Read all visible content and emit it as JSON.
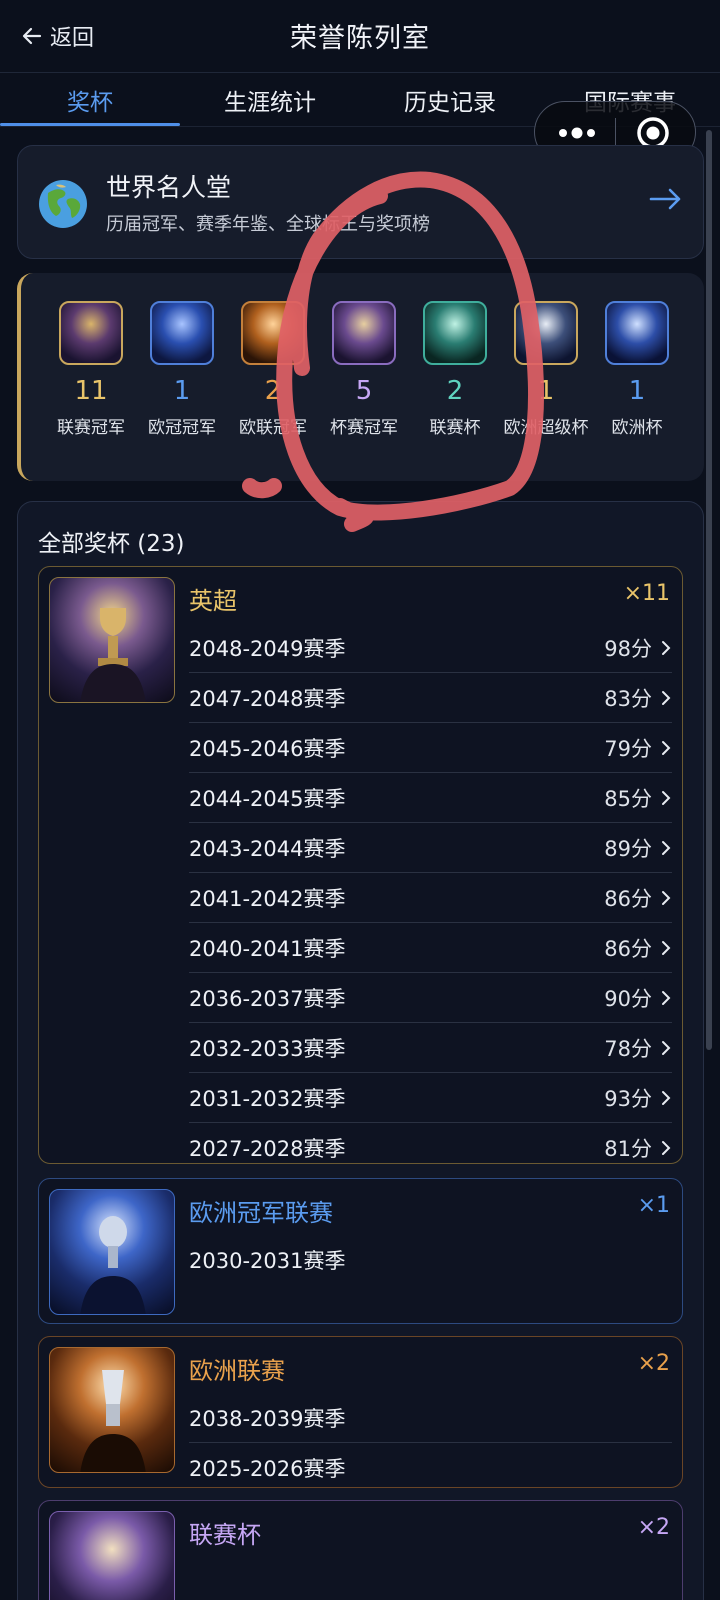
{
  "header": {
    "back_label": "返回",
    "title": "荣誉陈列室"
  },
  "tabs": [
    {
      "label": "奖杯",
      "active": true
    },
    {
      "label": "生涯统计",
      "active": false
    },
    {
      "label": "历史记录",
      "active": false
    },
    {
      "label": "国际赛事",
      "active": false
    }
  ],
  "hall_of_fame": {
    "title": "世界名人堂",
    "subtitle": "历届冠军、赛季年鉴、全球标王与奖项榜"
  },
  "summary": [
    {
      "count": "11",
      "label": "联赛冠军",
      "color": "#e9c46a"
    },
    {
      "count": "1",
      "label": "欧冠冠军",
      "color": "#5b9cf0"
    },
    {
      "count": "2",
      "label": "欧联冠军",
      "color": "#e9a14c"
    },
    {
      "count": "5",
      "label": "杯赛冠军",
      "color": "#c6a7f5"
    },
    {
      "count": "2",
      "label": "联赛杯",
      "color": "#5fd3c0"
    },
    {
      "count": "1",
      "label": "欧洲超级杯",
      "color": "#e9c46a"
    },
    {
      "count": "1",
      "label": "欧洲杯",
      "color": "#5b9cf0"
    }
  ],
  "all_trophies": {
    "title": "全部奖杯 (23)",
    "cards": [
      {
        "name": "英超",
        "count": "×11",
        "color": "#e9c46a",
        "seasons": [
          {
            "season": "2048-2049赛季",
            "score": "98分"
          },
          {
            "season": "2047-2048赛季",
            "score": "83分"
          },
          {
            "season": "2045-2046赛季",
            "score": "79分"
          },
          {
            "season": "2044-2045赛季",
            "score": "85分"
          },
          {
            "season": "2043-2044赛季",
            "score": "89分"
          },
          {
            "season": "2041-2042赛季",
            "score": "86分"
          },
          {
            "season": "2040-2041赛季",
            "score": "86分"
          },
          {
            "season": "2036-2037赛季",
            "score": "90分"
          },
          {
            "season": "2032-2033赛季",
            "score": "78分"
          },
          {
            "season": "2031-2032赛季",
            "score": "93分"
          },
          {
            "season": "2027-2028赛季",
            "score": "81分"
          }
        ]
      },
      {
        "name": "欧洲冠军联赛",
        "count": "×1",
        "color": "#5b9cf0",
        "seasons": [
          {
            "season": "2030-2031赛季"
          }
        ]
      },
      {
        "name": "欧洲联赛",
        "count": "×2",
        "color": "#e9a14c",
        "seasons": [
          {
            "season": "2038-2039赛季"
          },
          {
            "season": "2025-2026赛季"
          }
        ]
      },
      {
        "name": "联赛杯",
        "count": "×2",
        "color": "#c6a7f5",
        "seasons": []
      }
    ]
  }
}
